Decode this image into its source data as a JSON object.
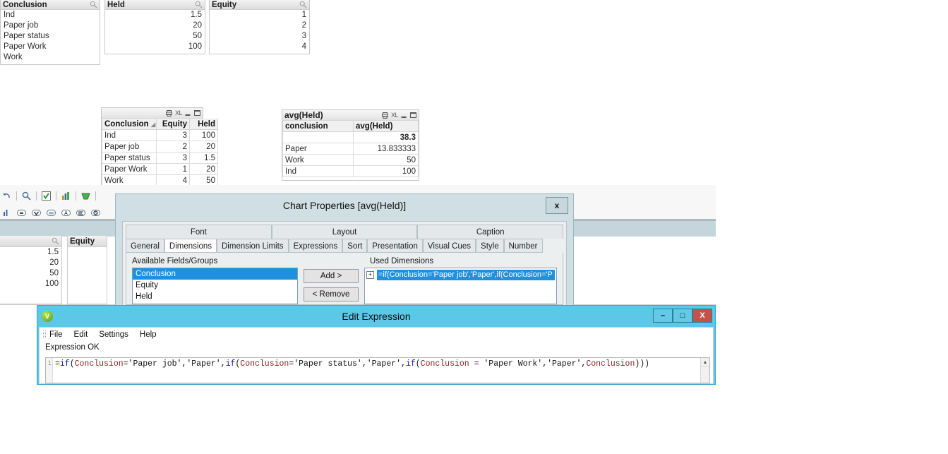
{
  "listboxes_top": [
    {
      "title": "Conclusion",
      "align": "left",
      "values": [
        "Ind",
        "Paper job",
        "Paper status",
        "Paper Work",
        "Work"
      ]
    },
    {
      "title": "Held",
      "align": "right",
      "values": [
        "1.5",
        "20",
        "50",
        "100"
      ]
    },
    {
      "title": "Equity",
      "align": "right",
      "values": [
        "1",
        "2",
        "3",
        "4"
      ]
    }
  ],
  "listboxes_behind": [
    {
      "title": "",
      "align": "right",
      "values": [
        "1.5",
        "20",
        "50",
        "100"
      ]
    },
    {
      "title": "Equity",
      "align": "right",
      "values": []
    }
  ],
  "straight_table": {
    "caption": "",
    "icons": [
      "print-icon",
      "excel-export-icon",
      "minimize-icon",
      "maximize-icon"
    ],
    "columns": [
      "Conclusion",
      "Equity",
      "Held"
    ],
    "sorted_column": "Conclusion",
    "rows": [
      [
        "Ind",
        "3",
        "100"
      ],
      [
        "Paper job",
        "2",
        "20"
      ],
      [
        "Paper status",
        "3",
        "1.5"
      ],
      [
        "Paper Work",
        "1",
        "20"
      ],
      [
        "Work",
        "4",
        "50"
      ]
    ]
  },
  "pivot_table": {
    "caption": "avg(Held)",
    "icons": [
      "print-icon",
      "excel-export-icon",
      "minimize-icon",
      "maximize-icon"
    ],
    "columns": [
      "conclusion",
      "avg(Held)"
    ],
    "total_row": [
      "",
      "38.3"
    ],
    "rows": [
      [
        "Paper",
        "13.833333"
      ],
      [
        "Work",
        "50"
      ],
      [
        "Ind",
        "100"
      ]
    ]
  },
  "chart_data": {
    "type": "table",
    "title": "avg(Held)",
    "columns": [
      "conclusion",
      "avg(Held)"
    ],
    "categories": [
      "Paper",
      "Work",
      "Ind"
    ],
    "values": [
      13.833333,
      50,
      100
    ],
    "total": 38.3,
    "xlabel": "conclusion",
    "ylabel": "avg(Held)"
  },
  "chart_properties": {
    "title": "Chart Properties [avg(Held)]",
    "close_label": "x",
    "tabs_top": [
      "Font",
      "Layout",
      "Caption"
    ],
    "tabs_bottom": [
      "General",
      "Dimensions",
      "Dimension Limits",
      "Expressions",
      "Sort",
      "Presentation",
      "Visual Cues",
      "Style",
      "Number"
    ],
    "active_tab": "Dimensions",
    "available_label": "Available Fields/Groups",
    "available_fields": [
      "Conclusion",
      "Equity",
      "Held"
    ],
    "selected_field": "Conclusion",
    "add_label": "Add >",
    "remove_label": "< Remove",
    "used_label": "Used Dimensions",
    "used_dimensions": [
      "=if(Conclusion='Paper job','Paper',if(Conclusion='P"
    ],
    "expand_glyph": "+"
  },
  "edit_expression": {
    "title": "Edit Expression",
    "logo_letter": "V",
    "minimize_label": "–",
    "maximize_label": "□",
    "close_label": "X",
    "menu": [
      "File",
      "Edit",
      "Settings",
      "Help"
    ],
    "status": "Expression OK",
    "line_number": "1",
    "expression": "=if(Conclusion='Paper job','Paper',if(Conclusion='Paper status','Paper',if(Conclusion = 'Paper Work','Paper',Conclusion)))",
    "expression_tokens": [
      {
        "t": "=",
        "c": "op"
      },
      {
        "t": "if",
        "c": "kw"
      },
      {
        "t": "(",
        "c": "op"
      },
      {
        "t": "Conclusion",
        "c": "fld"
      },
      {
        "t": "='Paper job','Paper',",
        "c": "str"
      },
      {
        "t": "if",
        "c": "kw"
      },
      {
        "t": "(",
        "c": "op"
      },
      {
        "t": "Conclusion",
        "c": "fld"
      },
      {
        "t": "='Paper status','Paper',",
        "c": "str"
      },
      {
        "t": "if",
        "c": "kw"
      },
      {
        "t": "(",
        "c": "op"
      },
      {
        "t": "Conclusion",
        "c": "fld"
      },
      {
        "t": " = 'Paper Work','Paper',",
        "c": "str"
      },
      {
        "t": "Conclusion",
        "c": "fld"
      },
      {
        "t": ")))",
        "c": "op"
      }
    ]
  },
  "colors": {
    "accent_blue": "#1e90e0",
    "titlebar_cyan": "#5bc8e8",
    "close_red": "#c4524a",
    "dialog_bg": "#cfdfe4",
    "band_blue": "#c4d6dc"
  }
}
